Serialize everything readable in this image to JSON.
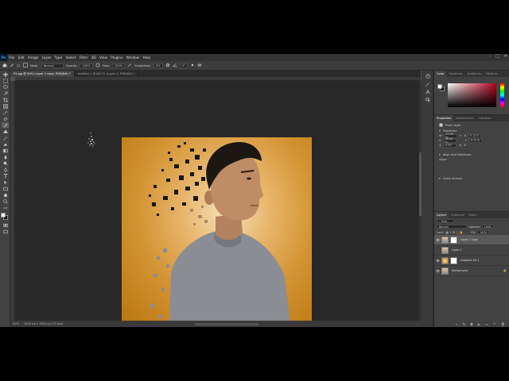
{
  "menu": {
    "logo": "Ps",
    "items": [
      "File",
      "Edit",
      "Image",
      "Layer",
      "Type",
      "Select",
      "Filter",
      "3D",
      "View",
      "Plugins",
      "Window",
      "Help"
    ]
  },
  "window_controls": [
    "–",
    "□",
    "✕"
  ],
  "options": {
    "size_label": "22",
    "mode_label": "Mode:",
    "mode_value": "Normal",
    "opacity_label": "Opacity:",
    "opacity_value": "100%",
    "flow_label": "Flow:",
    "flow_value": "100%",
    "smoothing_label": "Smoothing:",
    "smoothing_value": "0%",
    "angle_value": "0°"
  },
  "tabs": [
    {
      "label": "P1.jpg @ 50% (Layer 1 copy, RGB/8#) *",
      "active": true
    },
    {
      "label": "Untitled-1 @ 66.7% (Layer 1, RGB/8#) *",
      "active": false
    }
  ],
  "status": {
    "zoom": "50%",
    "doc": "1920 px x 1920 px (72 ppi)"
  },
  "color_panel": {
    "tabs": [
      "Color",
      "Swatches",
      "Gradients",
      "Patterns"
    ],
    "fg": "#ffffff",
    "bg": "#111111",
    "hue_color": "#b2001f"
  },
  "properties": {
    "tabs": [
      "Properties",
      "Adjustments",
      "Libraries"
    ],
    "layer_type": "Pixel Layer",
    "transform_label": "Transform",
    "w_label": "W",
    "w_value": "27.09 in",
    "x_label": "X",
    "x_value": "0.12 in",
    "h_label": "H",
    "h_value": "26.26 in",
    "y_label": "Y",
    "y_value": "0.12 in",
    "angle_value": "0.00°",
    "align_label": "Align and Distribute",
    "align_sub": "Align:",
    "quick_label": "Quick Actions"
  },
  "layers": {
    "tabs": [
      "Layers",
      "Channels",
      "Paths"
    ],
    "kind": "Kind",
    "blend": "Normal",
    "opacity_label": "Opacity:",
    "opacity_value": "100%",
    "lock_label": "Lock:",
    "fill_label": "Fill:",
    "fill_value": "100%",
    "items": [
      {
        "name": "Layer 1 copy",
        "visible": true,
        "selected": true
      },
      {
        "name": "Layer 1",
        "visible": false,
        "selected": false
      },
      {
        "name": "Gradient Fill 1",
        "visible": true,
        "selected": false
      },
      {
        "name": "Background",
        "visible": true,
        "selected": false
      }
    ]
  },
  "footer_icons": [
    "link-icon",
    "fx-icon",
    "mask-icon",
    "adjustment-icon",
    "folder-icon",
    "new-layer-icon",
    "trash-icon"
  ]
}
